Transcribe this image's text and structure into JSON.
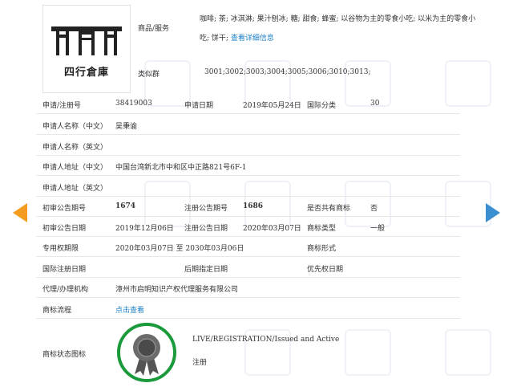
{
  "nav": {
    "prev_icon": "chevron-left-icon",
    "next_icon": "chevron-right-icon"
  },
  "logo": {
    "text": "四行倉庫"
  },
  "goods": {
    "label": "商品/服务",
    "line1": "咖啡; 茶; 冰淇淋; 果汁刨冰; 糖; 甜食; 蜂蜜; 以谷物为主的零食小吃; 以米为主的零食小",
    "line2": "吃; 饼干;",
    "link": "查看详细信息"
  },
  "similar": {
    "label": "类似群",
    "value": "3001;3002;3003;3004;3005;3006;3010;3013;"
  },
  "rows": {
    "reg_no_label": "申请/注册号",
    "reg_no": "38419003",
    "apply_date_label": "申请日期",
    "apply_date": "2019年05月24日",
    "intl_class_label": "国际分类",
    "intl_class": "30",
    "name_cn_label": "申请人名称（中文）",
    "name_cn": "吴秉谕",
    "name_en_label": "申请人名称（英文）",
    "addr_cn_label": "申请人地址（中文）",
    "addr_cn": "中国台湾新北市中和区中正路821号6F-1",
    "addr_en_label": "申请人地址（英文）",
    "prelim_no_label": "初审公告期号",
    "prelim_no": "1674",
    "reg_pub_no_label": "注册公告期号",
    "reg_pub_no": "1686",
    "shared_label": "是否共有商标",
    "shared": "否",
    "prelim_date_label": "初审公告日期",
    "prelim_date": "2019年12月06日",
    "reg_pub_date_label": "注册公告日期",
    "reg_pub_date": "2020年03月07日",
    "tm_type_label": "商标类型",
    "tm_type": "一般",
    "exclusive_label": "专用权期限",
    "exclusive": "2020年03月07日 至 2030年03月06日",
    "tm_form_label": "商标形式",
    "intl_reg_label": "国际注册日期",
    "later_date_label": "后期指定日期",
    "priority_label": "优先权日期",
    "agent_label": "代理/办理机构",
    "agent": "漳州市启明知识产权代理服务有限公司",
    "flow_label": "商标流程",
    "flow_link": "点击查看",
    "status_label": "商标状态图标",
    "status_en": "LIVE/REGISTRATION/Issued and Active",
    "status_cn": "注册"
  },
  "colors": {
    "accent_link": "#1a7fc8",
    "seal_green": "#1a9a3a",
    "prev_arrow": "#f39c1f",
    "next_arrow": "#3a8fd1"
  }
}
